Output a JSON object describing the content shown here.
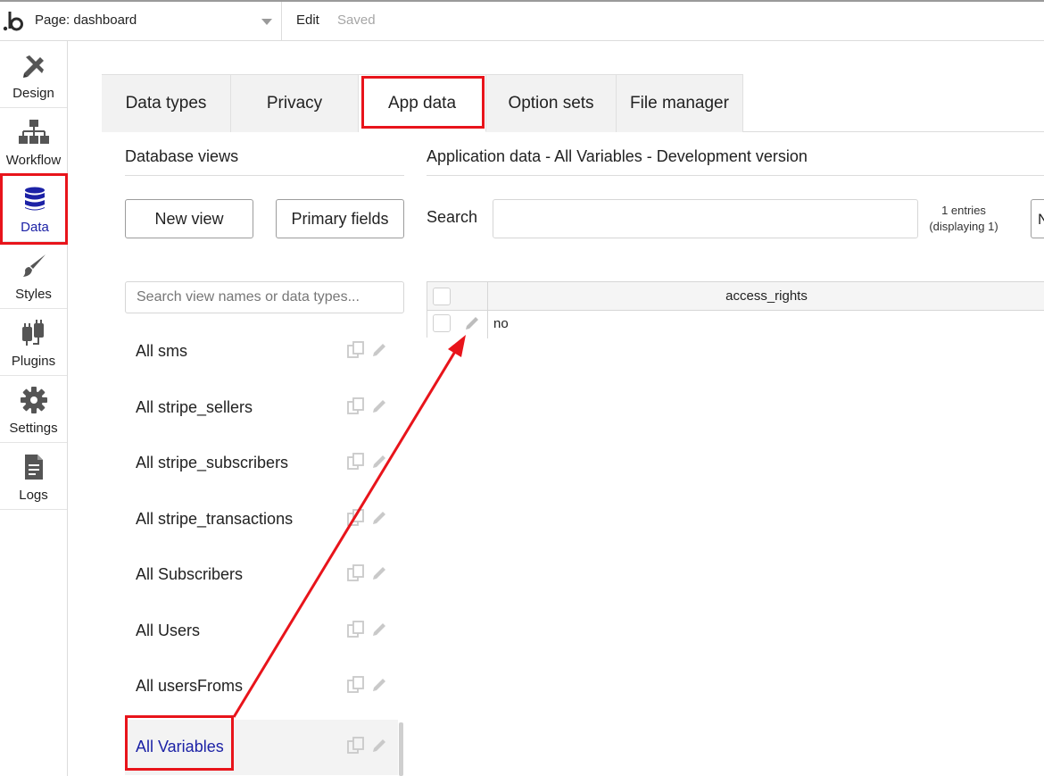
{
  "topbar": {
    "page_label": "Page: dashboard",
    "edit": "Edit",
    "status": "Saved"
  },
  "sidebar": {
    "items": [
      {
        "label": "Design",
        "icon": "design-icon"
      },
      {
        "label": "Workflow",
        "icon": "workflow-icon"
      },
      {
        "label": "Data",
        "icon": "database-icon",
        "active": true
      },
      {
        "label": "Styles",
        "icon": "brush-icon"
      },
      {
        "label": "Plugins",
        "icon": "plug-icon"
      },
      {
        "label": "Settings",
        "icon": "gear-icon"
      },
      {
        "label": "Logs",
        "icon": "document-icon"
      }
    ]
  },
  "tabs": [
    {
      "label": "Data types"
    },
    {
      "label": "Privacy"
    },
    {
      "label": "App data",
      "active": true
    },
    {
      "label": "Option sets"
    },
    {
      "label": "File manager"
    }
  ],
  "views": {
    "title": "Database views",
    "new_view": "New view",
    "primary_fields": "Primary fields",
    "search_placeholder": "Search view names or data types...",
    "items": [
      {
        "label": "All sms"
      },
      {
        "label": "All stripe_sellers"
      },
      {
        "label": "All stripe_subscribers"
      },
      {
        "label": "All stripe_transactions"
      },
      {
        "label": "All Subscribers"
      },
      {
        "label": "All Users"
      },
      {
        "label": "All usersFroms"
      },
      {
        "label": "All Variables",
        "selected": true
      }
    ]
  },
  "appdata": {
    "title": "Application data - All Variables - Development version",
    "search_label": "Search",
    "entries_line1": "1 entries",
    "entries_line2": "(displaying 1)",
    "cut_button": "N",
    "column": "access_rights",
    "rows": [
      {
        "access_rights": "no"
      }
    ]
  },
  "colors": {
    "accent": "#1c22a6",
    "highlight": "#e8141b"
  }
}
